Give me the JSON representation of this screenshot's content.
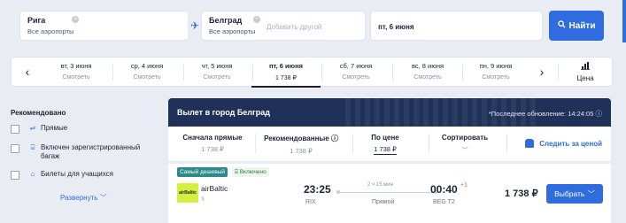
{
  "search": {
    "from_city": "Рига",
    "from_airports": "Все аэропорты",
    "to_city": "Белград",
    "to_airports": "Все аэропорты",
    "add_other": "Добавить другой",
    "date": "пт, 6 июня",
    "search_button": "Найти"
  },
  "dates": {
    "items": [
      {
        "day": "вт, 3 июня",
        "price": "Смотреть"
      },
      {
        "day": "ср, 4 июня",
        "price": "Смотреть"
      },
      {
        "day": "чт, 5 июня",
        "price": "Смотреть"
      },
      {
        "day": "пт, 6 июня",
        "price": "1 738 ₽"
      },
      {
        "day": "сб, 7 июня",
        "price": "Смотреть"
      },
      {
        "day": "вс, 8 июня",
        "price": "Смотреть"
      },
      {
        "day": "пн, 9 июня",
        "price": "Смотреть"
      }
    ],
    "price_sort_label": "Цена"
  },
  "sidebar": {
    "title": "Рекомендовано",
    "filters": [
      {
        "label": "Прямые",
        "icon": "direct-flight-icon"
      },
      {
        "label": "Включен зарегистрированный багаж",
        "icon": "baggage-icon"
      },
      {
        "label": "Билеты для учащихся",
        "icon": "student-icon"
      }
    ],
    "expand": "Развернуть"
  },
  "results": {
    "banner_title": "Вылет в город Белград",
    "last_update": "*Последнее обновление: 14:24:05",
    "sorts": [
      {
        "title": "Сначала прямые",
        "value": "1 738 ₽"
      },
      {
        "title": "Рекомендованные",
        "value": "1 738 ₽"
      },
      {
        "title": "По цене",
        "value": "1 738 ₽"
      },
      {
        "title": "Сортировать",
        "value": ""
      }
    ],
    "track_price": "Следить за ценой",
    "flight": {
      "tag_cheapest": "Самый дешевый",
      "tag_included": "Включено",
      "airline_logo": "airBaltic",
      "airline": "airBaltic",
      "dep_time": "23:25",
      "dep_code": "RIX",
      "duration": "2 ч 15 мин",
      "stops": "Прямой",
      "arr_time": "00:40",
      "day_offset": "+1",
      "arr_code": "BEG T2",
      "price": "1 738 ₽",
      "select_button": "Выбрать"
    }
  },
  "colors": {
    "accent": "#2f6cdd",
    "banner": "#1f3158",
    "cheapest_tag": "#2b8a8a",
    "logo": "#d4ef3e"
  }
}
